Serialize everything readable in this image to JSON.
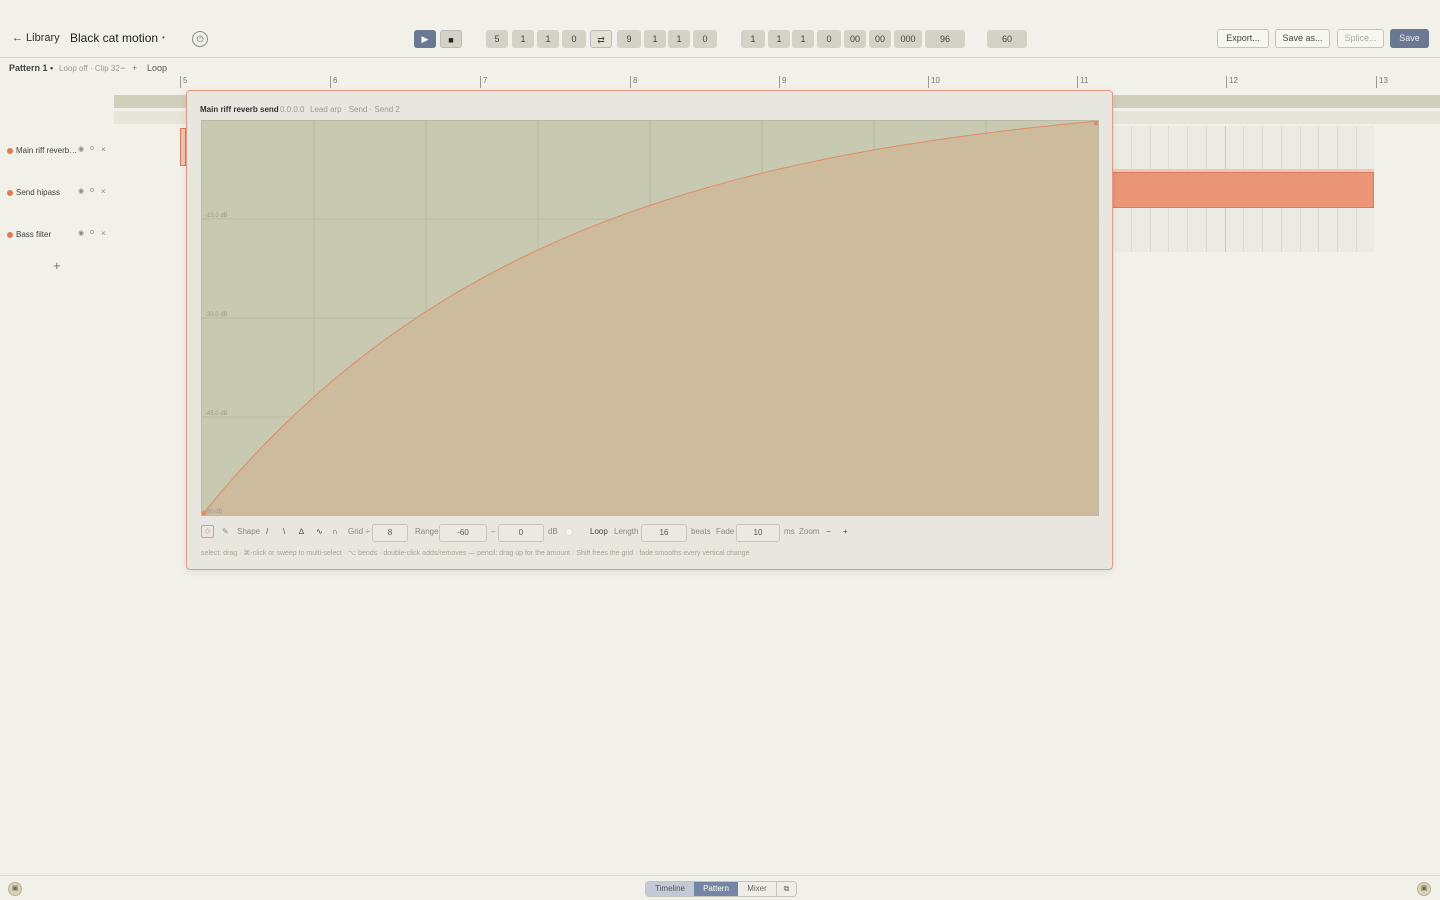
{
  "app": {
    "back_label": "← Library",
    "title": "Black cat motion",
    "title_caret": "•",
    "power_icon": "⏻"
  },
  "transport": {
    "play": "▶",
    "stop": "■",
    "loop_icon": "⇄",
    "position": [
      "5",
      "1",
      "1",
      "0"
    ],
    "loop_end": [
      "9",
      "1",
      "1",
      "0"
    ],
    "time": [
      "1",
      "1",
      "1",
      "0",
      "00",
      "00",
      "000"
    ],
    "ppq": "96",
    "tempo": "60"
  },
  "actions": {
    "export": "Export...",
    "save_as": "Save as...",
    "splice": "Splice...",
    "save": "Save"
  },
  "pattern": {
    "name": "Pattern 1 •",
    "meta": "Loop off · Clip 32",
    "minus": "−",
    "plus": "+",
    "loop": "Loop"
  },
  "ruler": [
    "5",
    "6",
    "7",
    "8",
    "9",
    "10",
    "11",
    "12",
    "13"
  ],
  "tracks": [
    {
      "name": "Main riff reverb…",
      "icon1": "◉",
      "icon2": "o",
      "icon3": "×"
    },
    {
      "name": "Send hipass",
      "icon1": "◉",
      "icon2": "o",
      "icon3": "×"
    },
    {
      "name": "Bass filter",
      "icon1": "◉",
      "icon2": "o",
      "icon3": "×"
    }
  ],
  "add_track": "+",
  "editor": {
    "title": "Main riff reverb send",
    "position": "0.0.0.0",
    "route": "Lead arp · Send · Send 2",
    "db_labels": [
      "-15.0 dB",
      "-30.0 dB",
      "-45.0 dB",
      "-60 dB"
    ],
    "curve": {
      "shape": "exponential",
      "from_db": -60,
      "to_db": 0
    },
    "tools": {
      "select_icon": "◇",
      "pencil_icon": "✎",
      "shape_label": "Shape",
      "shape_icons": [
        "/",
        "\\",
        "∆",
        "∿",
        "∩"
      ],
      "grid_label": "Grid ÷",
      "grid_value": "8",
      "range_label": "Range",
      "range_min": "-60",
      "range_sep": "–",
      "range_max": "0",
      "range_unit": "dB",
      "loop_label": "Loop",
      "length_label": "Length",
      "length_value": "16",
      "length_unit": "beats",
      "fade_label": "Fade",
      "fade_value": "10",
      "fade_unit": "ms",
      "zoom_label": "Zoom",
      "zoom_out": "−",
      "zoom_in": "+"
    },
    "hint": "select: drag · ⌘-click or sweep to multi-select · ⌥ bends · double-click adds/removes — pencil: drag up for the amount · Shift frees the grid · fade smooths every vertical change"
  },
  "bottom": {
    "left_icon": "▣",
    "right_icon": "▣",
    "tabs": [
      "Timeline",
      "Pattern",
      "Mixer"
    ],
    "popout_icon": "⧉"
  }
}
